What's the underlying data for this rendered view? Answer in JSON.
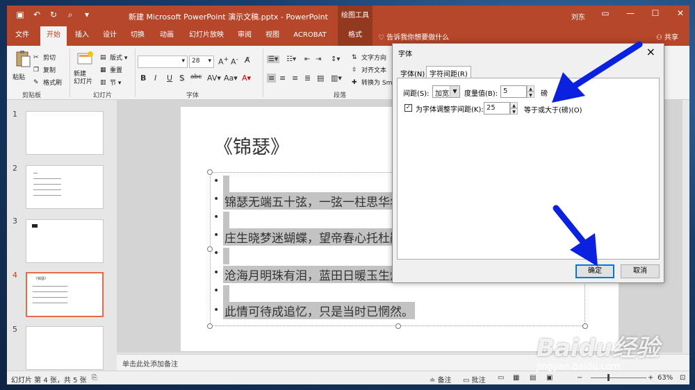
{
  "titlebar": {
    "title": "新建 Microsoft PowerPoint 演示文稿.pptx  -  PowerPoint",
    "context_tab": "绘图工具",
    "user": "刘东"
  },
  "tabs": [
    "文件",
    "开始",
    "插入",
    "设计",
    "切换",
    "动画",
    "幻灯片放映",
    "审阅",
    "视图",
    "ACROBAT",
    "格式"
  ],
  "active_tab": "开始",
  "tell_me": "告诉我你想要做什么",
  "share": "共享",
  "ribbon": {
    "clipboard": {
      "paste": "粘贴",
      "cut": "剪切",
      "copy": "复制",
      "format_painter": "格式刷",
      "label": "剪贴板"
    },
    "slides": {
      "new_slide": "新建\n幻灯片",
      "layout": "版式",
      "reset": "重置",
      "section": "节",
      "label": "幻灯片"
    },
    "font": {
      "size": "28",
      "label": "字体",
      "bold": "B",
      "italic": "I",
      "underline": "U",
      "strike": "S",
      "shadow": "abc"
    },
    "paragraph": {
      "label": "段落",
      "text_direction": "文字方向",
      "align_text": "对齐文本",
      "convert": "转换为 Sm"
    }
  },
  "thumbnails": [
    {
      "num": "1"
    },
    {
      "num": "2"
    },
    {
      "num": "3"
    },
    {
      "num": "4",
      "title": "《锦瑟》"
    },
    {
      "num": "5"
    }
  ],
  "slide": {
    "title": "《锦瑟》",
    "lines": [
      "锦瑟无端五十弦，一弦一柱思华年。",
      "庄生晓梦迷蝴蝶，望帝春心托杜鹃。",
      "沧海月明珠有泪，蓝田日暖玉生烟。",
      "此情可待成追忆，只是当时已惘然。"
    ]
  },
  "notes_placeholder": "单击此处添加备注",
  "statusbar": {
    "slide_info": "幻灯片 第 4 张，共 5 张",
    "notes": "备注",
    "comments": "批注",
    "zoom": "63%"
  },
  "dialog": {
    "title": "字体",
    "tab_font": "字体(N)",
    "tab_spacing": "字符间距(R)",
    "spacing_label": "间距(S):",
    "spacing_value": "加宽",
    "by_label": "度量值(B):",
    "by_value": "5",
    "unit": "磅",
    "kerning_label": "为字体调整字间距(K):",
    "kerning_value": "25",
    "kerning_suffix": "等于或大于(磅)(O)",
    "ok": "确定",
    "cancel": "取消"
  },
  "watermark": {
    "brand": "Baidu经验",
    "url": "jingyan.baidu.com"
  },
  "colors": {
    "accent": "#b7472a",
    "arrow": "#0a22e0",
    "selection": "#c3c3c3"
  }
}
